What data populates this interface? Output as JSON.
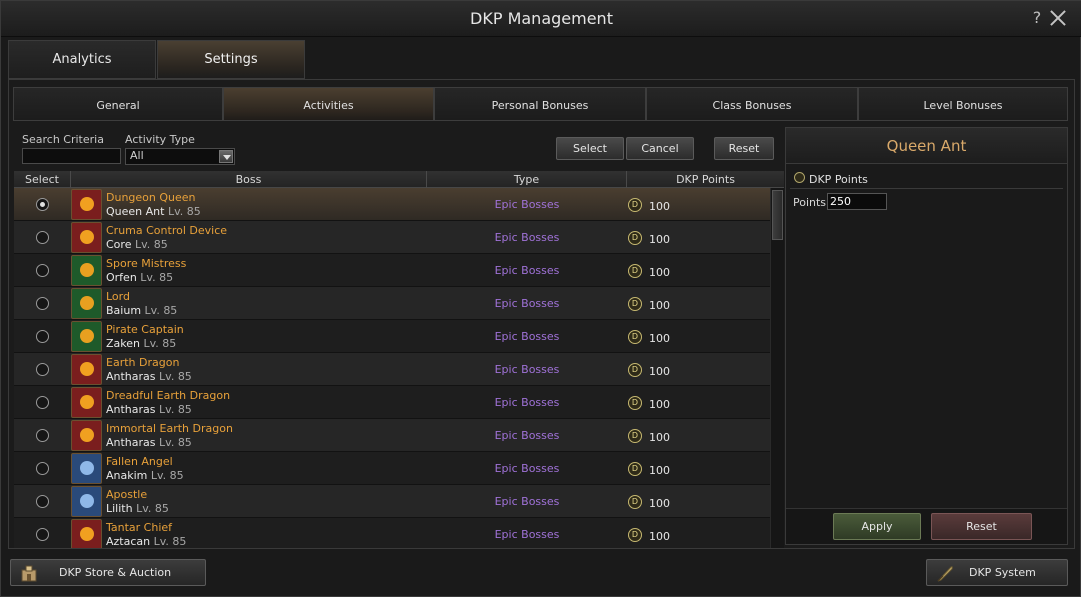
{
  "window": {
    "title": "DKP Management"
  },
  "main_tabs": [
    {
      "label": "Analytics",
      "active": false
    },
    {
      "label": "Settings",
      "active": true
    }
  ],
  "sub_tabs": [
    {
      "label": "General",
      "active": false
    },
    {
      "label": "Activities",
      "active": true
    },
    {
      "label": "Personal Bonuses",
      "active": false
    },
    {
      "label": "Class Bonuses",
      "active": false
    },
    {
      "label": "Level Bonuses",
      "active": false
    }
  ],
  "filters": {
    "search_label": "Search Criteria",
    "search_value": "",
    "activity_label": "Activity Type",
    "activity_value": "All",
    "select_button": "Select",
    "cancel_button": "Cancel",
    "reset_button": "Reset"
  },
  "table": {
    "headers": [
      "Select",
      "Boss",
      "Type",
      "DKP Points"
    ],
    "level_prefix": "Lv.",
    "rows": [
      {
        "selected": true,
        "name": "Dungeon Queen",
        "boss": "Queen Ant",
        "level": "85",
        "type": "Epic Bosses",
        "points": "100",
        "icon_color": "#f0a020",
        "icon_bg": "#7a1e1e"
      },
      {
        "selected": false,
        "name": "Cruma Control Device",
        "boss": "Core",
        "level": "85",
        "type": "Epic Bosses",
        "points": "100",
        "icon_color": "#f0a020",
        "icon_bg": "#7a1e1e"
      },
      {
        "selected": false,
        "name": "Spore Mistress",
        "boss": "Orfen",
        "level": "85",
        "type": "Epic Bosses",
        "points": "100",
        "icon_color": "#e8a020",
        "icon_bg": "#1e5a2a"
      },
      {
        "selected": false,
        "name": "Lord",
        "boss": "Baium",
        "level": "85",
        "type": "Epic Bosses",
        "points": "100",
        "icon_color": "#e8a020",
        "icon_bg": "#1e5a2a"
      },
      {
        "selected": false,
        "name": "Pirate Captain",
        "boss": "Zaken",
        "level": "85",
        "type": "Epic Bosses",
        "points": "100",
        "icon_color": "#e8a020",
        "icon_bg": "#1e5a2a"
      },
      {
        "selected": false,
        "name": "Earth Dragon",
        "boss": "Antharas",
        "level": "85",
        "type": "Epic Bosses",
        "points": "100",
        "icon_color": "#f0a020",
        "icon_bg": "#7a1e1e"
      },
      {
        "selected": false,
        "name": "Dreadful Earth Dragon",
        "boss": "Antharas",
        "level": "85",
        "type": "Epic Bosses",
        "points": "100",
        "icon_color": "#f0a020",
        "icon_bg": "#7a1e1e"
      },
      {
        "selected": false,
        "name": "Immortal Earth Dragon",
        "boss": "Antharas",
        "level": "85",
        "type": "Epic Bosses",
        "points": "100",
        "icon_color": "#f0a020",
        "icon_bg": "#7a1e1e"
      },
      {
        "selected": false,
        "name": "Fallen Angel",
        "boss": "Anakim",
        "level": "85",
        "type": "Epic Bosses",
        "points": "100",
        "icon_color": "#8fb8e8",
        "icon_bg": "#2a4a7a"
      },
      {
        "selected": false,
        "name": "Apostle",
        "boss": "Lilith",
        "level": "85",
        "type": "Epic Bosses",
        "points": "100",
        "icon_color": "#8fb8e8",
        "icon_bg": "#2a4a7a"
      },
      {
        "selected": false,
        "name": "Tantar Chief",
        "boss": "Aztacan",
        "level": "85",
        "type": "Epic Bosses",
        "points": "100",
        "icon_color": "#f0a020",
        "icon_bg": "#7a1e1e"
      }
    ]
  },
  "detail_panel": {
    "title": "Queen Ant",
    "section_label": "DKP Points",
    "points_label": "Points",
    "points_value": "250",
    "apply_button": "Apply",
    "reset_button": "Reset"
  },
  "bottom": {
    "store_button": "DKP Store & Auction",
    "system_button": "DKP System"
  },
  "colors": {
    "boss_name": "#e8a13a",
    "type_text": "#a072d8",
    "panel_title": "#d9a96a"
  }
}
